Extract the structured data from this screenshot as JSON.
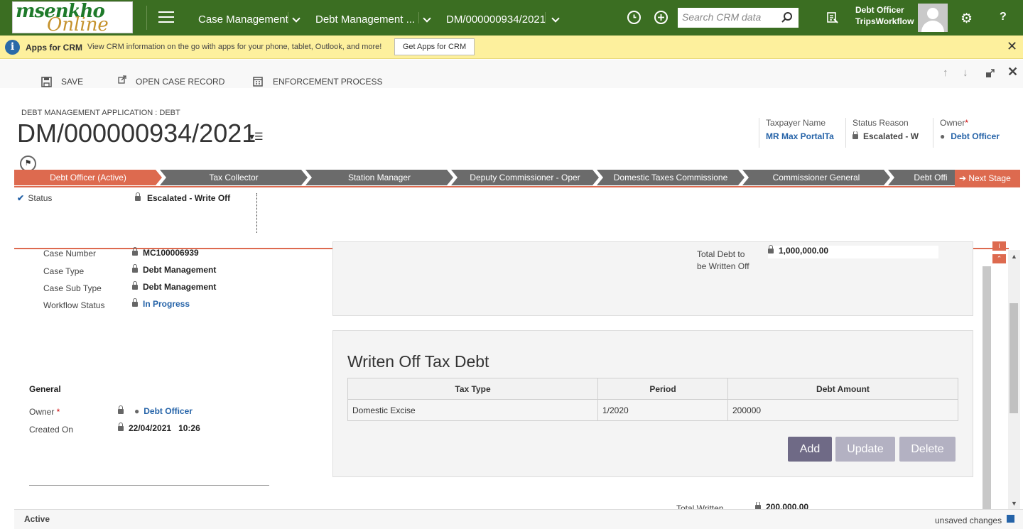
{
  "nav": {
    "logo_top": "msenkho",
    "logo_bottom": "Online",
    "area": "Case Management",
    "entity": "Debt Management ...",
    "record": "DM/000000934/2021",
    "search_placeholder": "Search CRM data",
    "user_role": "Debt Officer",
    "user_org": "TripsWorkflow",
    "help": "?"
  },
  "notification": {
    "title": "Apps for CRM",
    "message": "View CRM information on the go with apps for your phone, tablet, Outlook, and more!",
    "button": "Get Apps for CRM"
  },
  "commands": {
    "save": "SAVE",
    "open_case": "OPEN CASE RECORD",
    "enforcement": "ENFORCEMENT PROCESS"
  },
  "header": {
    "entity_form": "DEBT MANAGEMENT APPLICATION : DEBT",
    "record_title": "DM/000000934/2021",
    "taxpayer_label": "Taxpayer Name",
    "taxpayer_value": "MR Max PortalTa",
    "status_reason_label": "Status Reason",
    "status_reason_value": "Escalated - W",
    "owner_label": "Owner",
    "owner_value": "Debt Officer"
  },
  "process": {
    "stages": [
      "Debt Officer (Active)",
      "Tax Collector",
      "Station Manager",
      "Deputy Commissioner - Oper",
      "Domestic Taxes Commissione",
      "Commissioner General",
      "Debt Offi"
    ],
    "next_stage": "Next Stage",
    "status_label": "Status",
    "status_value": "Escalated - Write Off"
  },
  "details": {
    "case_number_label": "Case Number",
    "case_number": "MC100006939",
    "case_type_label": "Case Type",
    "case_type": "Debt Management",
    "case_sub_type_label": "Case Sub Type",
    "case_sub_type": "Debt Management",
    "workflow_status_label": "Workflow Status",
    "workflow_status": "In Progress",
    "total_debt_label": "Total Debt to be Written Off",
    "total_debt": "1,000,000.00"
  },
  "general": {
    "heading": "General",
    "owner_label": "Owner",
    "owner": "Debt Officer",
    "created_label": "Created On",
    "created_date": "22/04/2021",
    "created_time": "10:26"
  },
  "writeoff": {
    "title": "Writen Off Tax Debt",
    "columns": [
      "Tax Type",
      "Period",
      "Debt Amount"
    ],
    "rows": [
      [
        "Domestic Excise",
        "1/2020",
        "200000"
      ]
    ],
    "add": "Add",
    "update": "Update",
    "delete": "Delete",
    "total_label": "Total Written",
    "total_value": "200,000.00"
  },
  "footer": {
    "state": "Active",
    "unsaved": "unsaved changes"
  },
  "colors": {
    "nav": "#3b6e22",
    "accent": "#dd6a4f",
    "link": "#2563a8",
    "notif": "#fdf09d"
  }
}
